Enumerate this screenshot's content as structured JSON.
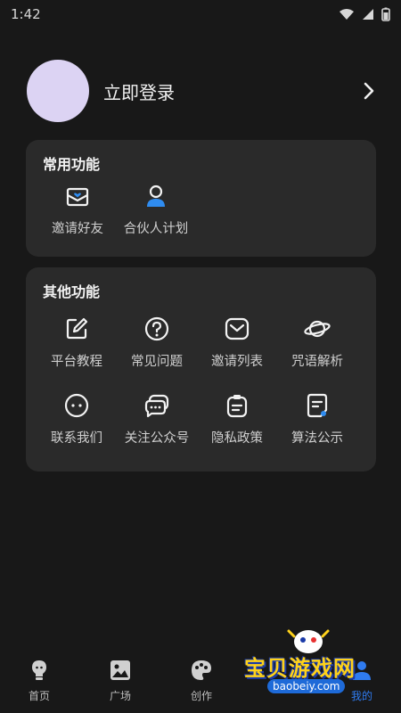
{
  "status_bar": {
    "time": "1:42"
  },
  "profile": {
    "login_label": "立即登录"
  },
  "common": {
    "title": "常用功能",
    "items": [
      {
        "label": "邀请好友",
        "icon": "invite-mail-icon"
      },
      {
        "label": "合伙人计划",
        "icon": "partner-person-icon"
      }
    ]
  },
  "other": {
    "title": "其他功能",
    "items": [
      {
        "label": "平台教程",
        "icon": "edit-icon"
      },
      {
        "label": "常见问题",
        "icon": "question-icon"
      },
      {
        "label": "邀请列表",
        "icon": "mailbox-icon"
      },
      {
        "label": "咒语解析",
        "icon": "planet-icon"
      },
      {
        "label": "联系我们",
        "icon": "chat-face-icon"
      },
      {
        "label": "关注公众号",
        "icon": "chat-bubbles-icon"
      },
      {
        "label": "隐私政策",
        "icon": "clipboard-icon"
      },
      {
        "label": "算法公示",
        "icon": "document-icon"
      }
    ]
  },
  "tabs": [
    {
      "label": "首页",
      "icon": "bulb-icon"
    },
    {
      "label": "广场",
      "icon": "image-icon"
    },
    {
      "label": "创作",
      "icon": "palette-icon"
    },
    {
      "label": "我的",
      "icon": "user-icon",
      "active": true
    }
  ],
  "watermark": {
    "text": "宝贝游戏网",
    "url": "baobeiy.com"
  },
  "colors": {
    "background": "#181818",
    "card": "#2a2a2a",
    "accent": "#2f7bf0",
    "avatar": "#dcd3f3"
  }
}
